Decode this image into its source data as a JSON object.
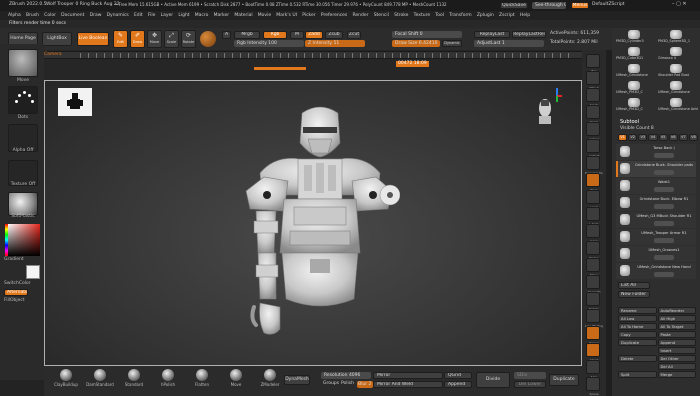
{
  "title_bar": {
    "app": "ZBrush 2022.0.5",
    "doc": "Wolf Trooper 0 Ring Buck Aug 22",
    "stats": "• Free Mem 15.615GB • Active Mem 6199 • Scratch Disk 2877 • BootTime 0.08 ZTime 0.532 RTime 30.056 Timer 29.976 • PolyCount 849.778 MP • MeshCount 1132",
    "quicksave": "QuickSave",
    "seethrough": "See-through 0",
    "menus_btn": "Menus",
    "script": "DefaultZScript"
  },
  "menu_bar": [
    "Alpha",
    "Brush",
    "Color",
    "Document",
    "Draw",
    "Dynamics",
    "Edit",
    "File",
    "Layer",
    "Light",
    "Macro",
    "Marker",
    "Material",
    "Movie",
    "Mark's UI",
    "Picker",
    "Preferences",
    "Render",
    "Stencil",
    "Stroke",
    "Texture",
    "Tool",
    "Transform",
    "Zplugin",
    "Zscript",
    "Help"
  ],
  "status_line": "Filters render time 0 secs",
  "shelf": {
    "home_page": "Home Page",
    "lightbox": "LightBox",
    "live_boolean": "Live Boolean",
    "edit": "Edit",
    "draw": "Draw",
    "move": "Move",
    "scale": "Scale",
    "rotate": "Rotate",
    "a_btn": "A",
    "mrgb": "Mrgb",
    "rgb": "Rgb",
    "m": "M",
    "zadd": "Zadd",
    "zsub": "Zsub",
    "zcut": "Zcut",
    "rgb_intensity": "Rgb Intensity 100",
    "z_intensity": "Z Intensity 51",
    "focal_shift": "Focal Shift 0",
    "draw_size": "Draw Size 6.42410",
    "dynamic": "Dynamic",
    "replay_last": "ReplayLast",
    "replay_last_rel": "ReplayLastRel",
    "adjust_last": "AdjustLast 1",
    "active_points": "ActivePoints: 611,359",
    "total_points": "TotalPoints: 2.807 Mil"
  },
  "camera_label": "Camera",
  "ruler_value": "00472 18:09",
  "left_tray": {
    "move": "Move",
    "dots": "Dots",
    "alpha_off": "Alpha Off",
    "texture_off": "Texture Off",
    "material": "SoftPlastic",
    "gradient": "Gradient",
    "switch_color": "SwitchColor",
    "alternate": "Alternate",
    "fill_object": "FillObject"
  },
  "right_nav": [
    "Bpr",
    "SPix 3",
    "Scroll",
    "Zoom",
    "Actual",
    "AAHalf",
    "Dynamic Persp",
    "Floor",
    "Local",
    "L.Sym",
    "Gxyz",
    "Frame",
    "Move",
    "Zoom3D",
    "Rotate",
    "Line Fill PolyF",
    "Transp",
    "Ghost",
    "Solo",
    "Xpose"
  ],
  "tool_palette": {
    "thumbs": [
      "PM3D_Cylinder3",
      "PM3D_Sphere3D_1",
      "PM3D_Cube3D1",
      "Gimasco 4",
      "UMesh_Grindstone",
      "Shoulder Pad Bust",
      "UMesh_PM3D_C",
      "UMesh_Grindstone",
      "UMesh_PM3D_C",
      "UMesh_Grindstone Ankle Details Lac"
    ],
    "subtool_title": "Subtool",
    "visible_count": "Visible Count 8",
    "vtabs": [
      "V1",
      "V2",
      "V3",
      "V4",
      "V5",
      "V6",
      "V7",
      "V8"
    ],
    "subtools": [
      "Torso Back (",
      "Grindstone Buck- Shoulder pads",
      "Waist1",
      "Grindstone Buck- Elbow R1",
      "UMesh_G3 MBuck Shoulder R1",
      "UMesh_Trooper Armor R1",
      "UMesh_Grooves1",
      "UMesh_Grindstone New Hand"
    ],
    "list_all": "List All",
    "new_folder": "New Folder",
    "buttons": [
      "Rename",
      "AutoReorder",
      "All Low",
      "All High",
      "All To Home",
      "All To Target",
      "Copy",
      "Paste",
      "Duplicate",
      "Append",
      "",
      "Insert",
      "Delete",
      "Del Other",
      "",
      "Del All",
      "Split",
      "Merge"
    ]
  },
  "bottom_bar": {
    "brushes": [
      "ClayBuildup",
      "DamStandard",
      "Standard",
      "hPolish",
      "Flatten",
      "Move",
      "ZModeler"
    ],
    "dynamesh": "DynaMesh",
    "resolution": "Resolution 4096",
    "groups": "Groups",
    "polish": "Polish",
    "blur": "Blur 2",
    "mirror": "Mirror",
    "mirror_weld": "Mirror And Weld",
    "qgrid": "QGrid",
    "append": "Append",
    "divide": "Divide",
    "sdiv": "SDiv",
    "duplicate": "Duplicate",
    "del_lower": "Del Lower"
  },
  "colors": {
    "accent": "#e2781c",
    "canvas": "#2f2f2f",
    "model": "#d9d9d9"
  }
}
